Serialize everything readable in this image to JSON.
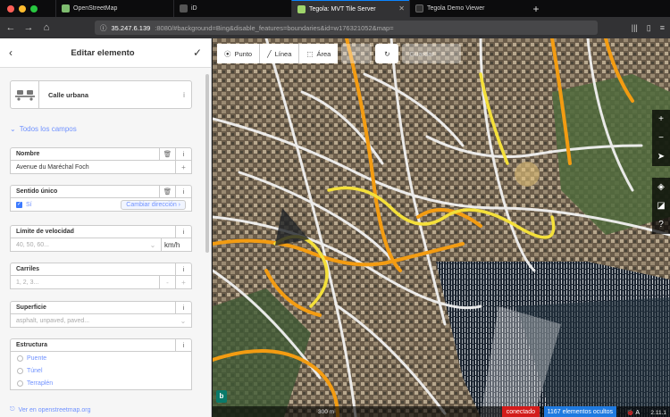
{
  "browser": {
    "tabs": [
      {
        "label": "OpenStreetMap",
        "fav": "#7ebc6f"
      },
      {
        "label": "iD",
        "fav": "#555"
      },
      {
        "label": "Tegola: MVT Tile Server",
        "fav": "#9fd46b",
        "active": true
      },
      {
        "label": "Tegola Demo Viewer",
        "fav": "#333"
      }
    ],
    "url_host": "35.247.6.139",
    "url_rest": ":8080/#background=Bing&disable_features=boundaries&id=w176321052&map="
  },
  "sidebar": {
    "header_title": "Editar elemento",
    "preset_name": "Calle urbana",
    "section_toggle": "Todos los campos",
    "fields": {
      "name_label": "Nombre",
      "name_value": "Avenue du Maréchal Foch",
      "oneway_label": "Sentido único",
      "oneway_value": "Sí",
      "oneway_button": "Cambiar dirección",
      "maxspeed_label": "Límite de velocidad",
      "maxspeed_placeholder": "40, 50, 60...",
      "maxspeed_unit": "km/h",
      "lanes_label": "Carriles",
      "lanes_placeholder": "1, 2, 3...",
      "surface_label": "Superficie",
      "surface_placeholder": "asphalt, unpaved, paved...",
      "structure_label": "Estructura",
      "structure_options": [
        "Puente",
        "Túnel",
        "Terraplén"
      ]
    },
    "footer_link": "Ver en openstreetmap.org"
  },
  "map": {
    "toolbar": {
      "point": "Punto",
      "line": "Línea",
      "area": "Área",
      "save": "Guardar"
    },
    "footer": {
      "scale": "300 m",
      "status": "conectado",
      "hidden": "1167 elementos ocultos",
      "version": "2.11.1"
    }
  }
}
